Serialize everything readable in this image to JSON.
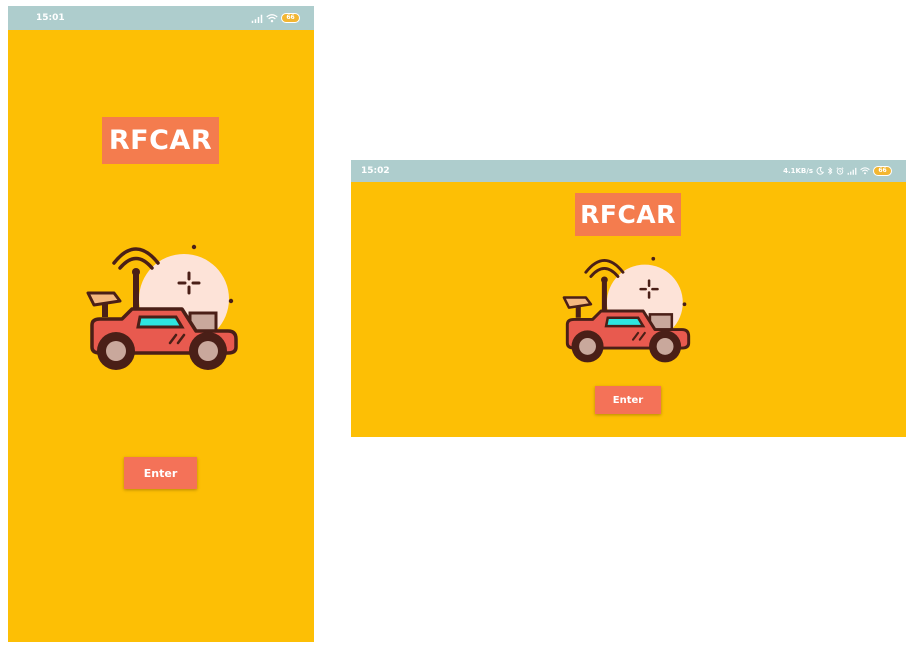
{
  "colors": {
    "background": "#fdbf05",
    "status_bar": "#aecdcd",
    "logo_bg": "#f47c4e",
    "button_bg": "#f47258",
    "car_body": "#e85a4f",
    "windshield": "#2ee6e0",
    "outline": "#4a1f17"
  },
  "portrait": {
    "status_bar": {
      "time": "15:01",
      "icons": [
        "signal-icon",
        "wifi-icon"
      ],
      "battery": "66"
    },
    "logo_text": "RFCAR",
    "illustration": "rc-car-icon",
    "enter_button": "Enter"
  },
  "landscape": {
    "status_bar": {
      "time": "15:02",
      "network_speed": "4.1KB/s",
      "icons": [
        "moon-icon",
        "bluetooth-icon",
        "alarm-icon",
        "signal-icon",
        "wifi-icon"
      ],
      "battery": "66"
    },
    "logo_text": "RFCAR",
    "illustration": "rc-car-icon",
    "enter_button": "Enter"
  }
}
